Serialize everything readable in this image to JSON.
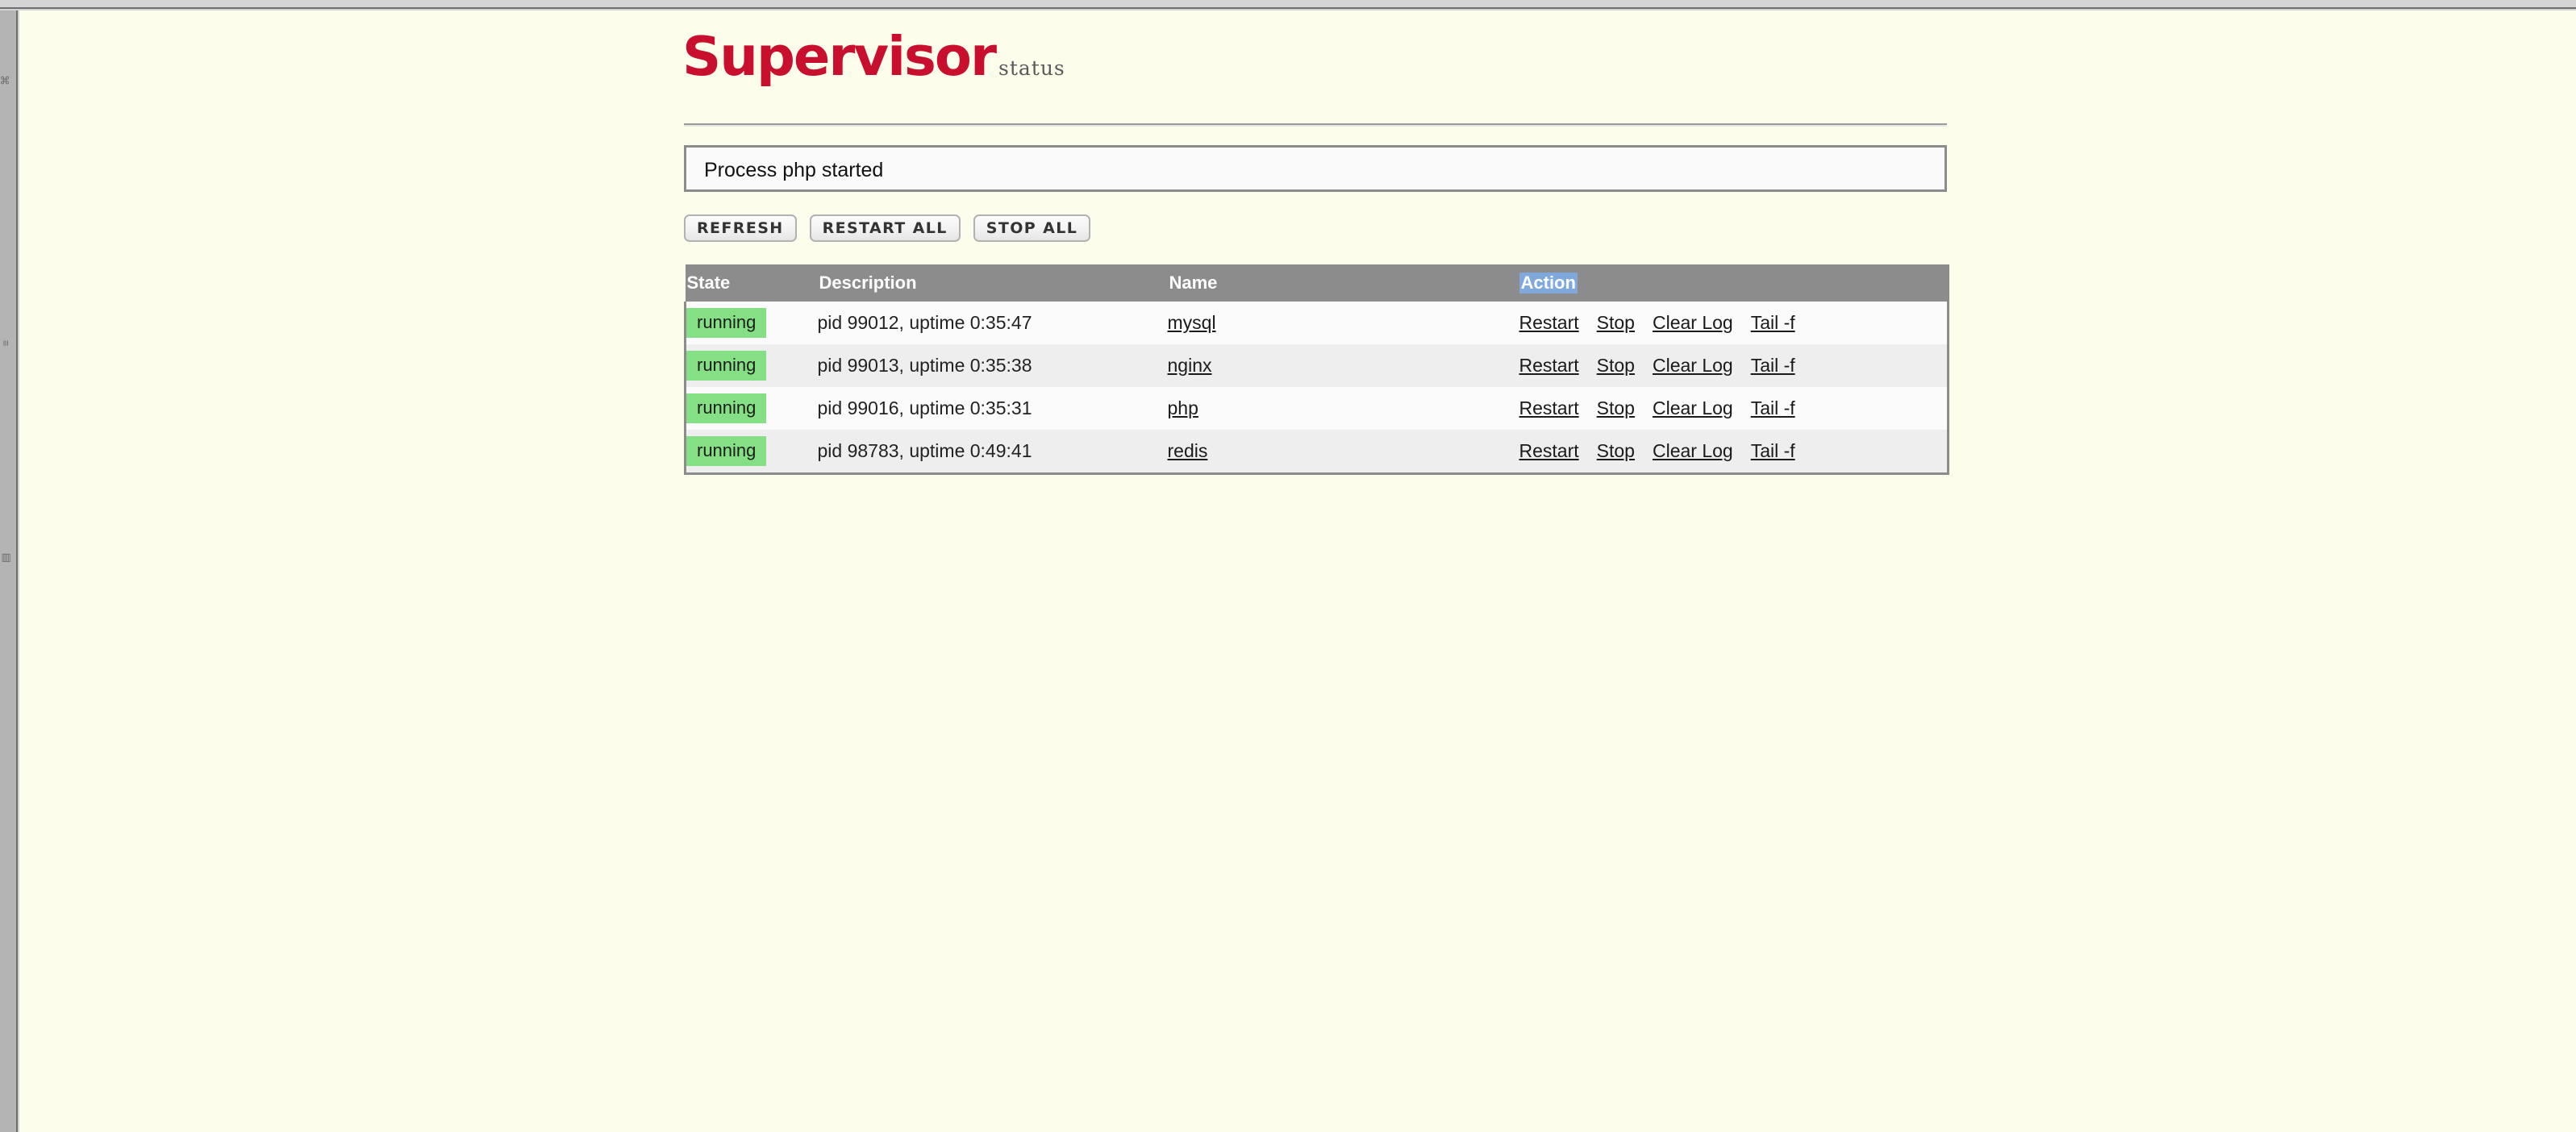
{
  "browser": {
    "chrome_ghost_marks": [
      "⌘",
      "≡",
      "▤"
    ]
  },
  "header": {
    "logo_main": "Supervisor",
    "logo_sub": "status"
  },
  "status": {
    "message": "Process php started"
  },
  "toolbar": {
    "buttons": [
      {
        "label": "REFRESH",
        "name": "refresh-button"
      },
      {
        "label": "RESTART ALL",
        "name": "restart-all-button"
      },
      {
        "label": "STOP ALL",
        "name": "stop-all-button"
      }
    ]
  },
  "table": {
    "columns": [
      {
        "label": "State",
        "selected": false
      },
      {
        "label": "Description",
        "selected": false
      },
      {
        "label": "Name",
        "selected": false
      },
      {
        "label": "Action",
        "selected": true
      }
    ],
    "action_labels": [
      "Restart",
      "Stop",
      "Clear Log",
      "Tail -f"
    ],
    "rows": [
      {
        "state": "running",
        "description": "pid 99012, uptime 0:35:47",
        "name": "mysql",
        "actions": [
          "Restart",
          "Stop",
          "Clear Log",
          "Tail -f"
        ]
      },
      {
        "state": "running",
        "description": "pid 99013, uptime 0:35:38",
        "name": "nginx",
        "actions": [
          "Restart",
          "Stop",
          "Clear Log",
          "Tail -f"
        ]
      },
      {
        "state": "running",
        "description": "pid 99016, uptime 0:35:31",
        "name": "php",
        "actions": [
          "Restart",
          "Stop",
          "Clear Log",
          "Tail -f"
        ]
      },
      {
        "state": "running",
        "description": "pid 98783, uptime 0:49:41",
        "name": "redis",
        "actions": [
          "Restart",
          "Stop",
          "Clear Log",
          "Tail -f"
        ]
      }
    ]
  },
  "colors": {
    "page_background": "#fdfdec",
    "logo_red": "#c8102e",
    "table_header_gray": "#8c8c8c",
    "row_odd": "#fbfbfb",
    "row_even": "#eeeeee",
    "running_green": "#85e085",
    "selection_blue": "#7fa9dd"
  }
}
